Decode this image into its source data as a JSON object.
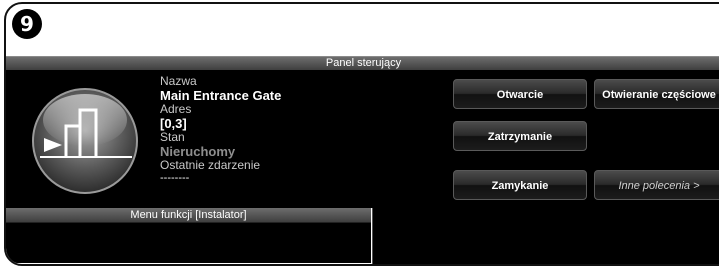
{
  "step_number": "9",
  "panel": {
    "title": "Panel sterujący",
    "name_label": "Nazwa",
    "name_value": "Main Entrance Gate",
    "address_label": "Adres",
    "address_value": "[0,3]",
    "status_label": "Stan",
    "status_value": "Nieruchomy",
    "last_event_label": "Ostatnie zdarzenie",
    "last_event_value": "--------"
  },
  "buttons": {
    "open": "Otwarcie",
    "partial_open": "Otwieranie częściowe",
    "stop": "Zatrzymanie",
    "close": "Zamykanie",
    "other": "Inne polecenia >"
  },
  "menu": {
    "title": "Menu funkcji [Instalator]"
  },
  "icons": {
    "gate": "gate-icon"
  }
}
